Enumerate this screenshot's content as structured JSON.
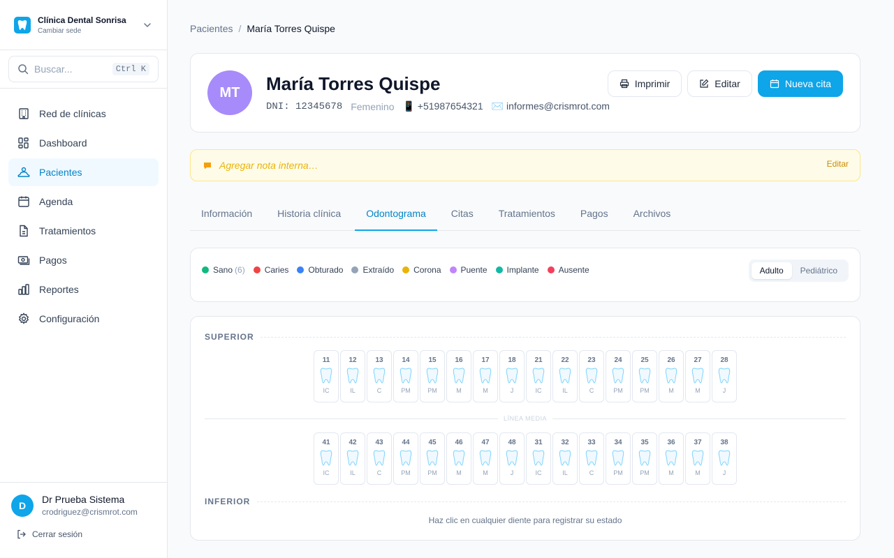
{
  "brand": {
    "name": "Clínica Dental Sonrisa",
    "subtitle": "Cambiar sede"
  },
  "search": {
    "placeholder": "Buscar...",
    "shortcut": "Ctrl K"
  },
  "nav": [
    {
      "label": "Red de clínicas",
      "icon": "building-icon",
      "active": false
    },
    {
      "label": "Dashboard",
      "icon": "dashboard-icon",
      "active": false
    },
    {
      "label": "Pacientes",
      "icon": "users-icon",
      "active": true
    },
    {
      "label": "Agenda",
      "icon": "calendar-icon",
      "active": false
    },
    {
      "label": "Tratamientos",
      "icon": "file-text-icon",
      "active": false
    },
    {
      "label": "Pagos",
      "icon": "money-icon",
      "active": false
    },
    {
      "label": "Reportes",
      "icon": "bar-chart-icon",
      "active": false
    },
    {
      "label": "Configuración",
      "icon": "gear-icon",
      "active": false
    }
  ],
  "user": {
    "initial": "D",
    "name": "Dr Prueba Sistema",
    "email": "crodriguez@crismrot.com",
    "logout_label": "Cerrar sesión"
  },
  "breadcrumb": {
    "parent": "Pacientes",
    "separator": "/",
    "current": "María Torres Quispe"
  },
  "patient": {
    "initials": "MT",
    "name": "María Torres Quispe",
    "dni": "DNI: 12345678",
    "gender": "Femenino",
    "phone": "📱 +51987654321",
    "email": "✉️ informes@crismrot.com",
    "avatar_color": "#a78bfa"
  },
  "actions": {
    "print": "Imprimir",
    "edit": "Editar",
    "new_appointment": "Nueva cita"
  },
  "note": {
    "placeholder": "Agregar nota interna…",
    "edit_label": "Editar"
  },
  "tabs": [
    {
      "label": "Información",
      "active": false
    },
    {
      "label": "Historia clínica",
      "active": false
    },
    {
      "label": "Odontograma",
      "active": true
    },
    {
      "label": "Citas",
      "active": false
    },
    {
      "label": "Tratamientos",
      "active": false
    },
    {
      "label": "Pagos",
      "active": false
    },
    {
      "label": "Archivos",
      "active": false
    }
  ],
  "legend": [
    {
      "label": "Sano",
      "count": "(6)",
      "color": "#10b981"
    },
    {
      "label": "Caries",
      "count": "",
      "color": "#ef4444"
    },
    {
      "label": "Obturado",
      "count": "",
      "color": "#3b82f6"
    },
    {
      "label": "Extraído",
      "count": "",
      "color": "#94a3b8"
    },
    {
      "label": "Corona",
      "count": "",
      "color": "#eab308"
    },
    {
      "label": "Puente",
      "count": "",
      "color": "#c084fc"
    },
    {
      "label": "Implante",
      "count": "",
      "color": "#14b8a6"
    },
    {
      "label": "Ausente",
      "count": "",
      "color": "#f43f5e"
    }
  ],
  "dentition_toggle": {
    "adult": "Adulto",
    "pediatric": "Pediátrico",
    "selected": "Adulto"
  },
  "odontogram": {
    "upper_label": "SUPERIOR",
    "lower_label": "INFERIOR",
    "midline_label": "LÍNEA MEDIA",
    "hint": "Haz clic en cualquier diente para registrar su estado",
    "upper": [
      {
        "num": "11",
        "type": "IC"
      },
      {
        "num": "12",
        "type": "IL"
      },
      {
        "num": "13",
        "type": "C"
      },
      {
        "num": "14",
        "type": "PM"
      },
      {
        "num": "15",
        "type": "PM"
      },
      {
        "num": "16",
        "type": "M"
      },
      {
        "num": "17",
        "type": "M"
      },
      {
        "num": "18",
        "type": "J"
      },
      {
        "num": "21",
        "type": "IC"
      },
      {
        "num": "22",
        "type": "IL"
      },
      {
        "num": "23",
        "type": "C"
      },
      {
        "num": "24",
        "type": "PM"
      },
      {
        "num": "25",
        "type": "PM"
      },
      {
        "num": "26",
        "type": "M"
      },
      {
        "num": "27",
        "type": "M"
      },
      {
        "num": "28",
        "type": "J"
      }
    ],
    "lower": [
      {
        "num": "41",
        "type": "IC"
      },
      {
        "num": "42",
        "type": "IL"
      },
      {
        "num": "43",
        "type": "C"
      },
      {
        "num": "44",
        "type": "PM"
      },
      {
        "num": "45",
        "type": "PM"
      },
      {
        "num": "46",
        "type": "M"
      },
      {
        "num": "47",
        "type": "M"
      },
      {
        "num": "48",
        "type": "J"
      },
      {
        "num": "31",
        "type": "IC"
      },
      {
        "num": "32",
        "type": "IL"
      },
      {
        "num": "33",
        "type": "C"
      },
      {
        "num": "34",
        "type": "PM"
      },
      {
        "num": "35",
        "type": "PM"
      },
      {
        "num": "36",
        "type": "M"
      },
      {
        "num": "37",
        "type": "M"
      },
      {
        "num": "38",
        "type": "J"
      }
    ]
  },
  "colors": {
    "accent": "#0ea5e9",
    "accent_dark": "#0284c7",
    "note_bg": "#fefce8",
    "tooth_outline": "#7dd3fc"
  }
}
